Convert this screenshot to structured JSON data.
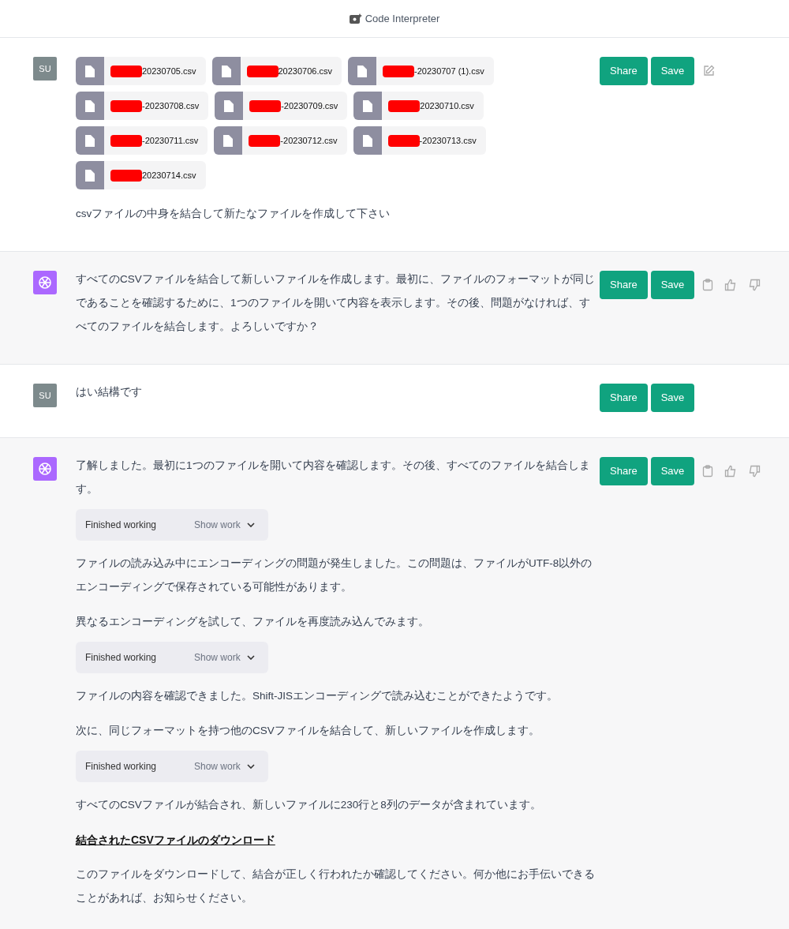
{
  "header": {
    "title": "Code Interpreter"
  },
  "messages": [
    {
      "kind": "user",
      "avatar": "SU",
      "files": [
        {
          "name": "20230705.csv",
          "redacted": true
        },
        {
          "name": "20230706.csv",
          "redacted": true
        },
        {
          "name": "-20230707 (1).csv",
          "redacted": true
        },
        {
          "name": "-20230708.csv",
          "redacted": true
        },
        {
          "name": "-20230709.csv",
          "redacted": true
        },
        {
          "name": "20230710.csv",
          "redacted": true
        },
        {
          "name": "-20230711.csv",
          "redacted": true
        },
        {
          "name": "-20230712.csv",
          "redacted": true
        },
        {
          "name": "-20230713.csv",
          "redacted": true
        },
        {
          "name": "20230714.csv",
          "redacted": true
        }
      ],
      "blocks": [
        {
          "kind": "paragraph",
          "text": "csvファイルの中身を結合して新たなファイルを作成して下さい"
        }
      ],
      "buttons": [
        "Share",
        "Save"
      ],
      "actions": [
        {
          "kind": "edit"
        }
      ]
    },
    {
      "kind": "assistant",
      "blocks": [
        {
          "kind": "paragraph",
          "text": "すべてのCSVファイルを結合して新しいファイルを作成します。最初に、ファイルのフォーマットが同じであることを確認するために、1つのファイルを開いて内容を表示します。その後、問題がなければ、すべてのファイルを結合します。よろしいですか？"
        }
      ],
      "buttons": [
        "Share",
        "Save"
      ],
      "actions": [
        {
          "kind": "copy"
        },
        {
          "kind": "thumbs-up"
        },
        {
          "kind": "thumbs-down"
        }
      ]
    },
    {
      "kind": "user",
      "avatar": "SU",
      "blocks": [
        {
          "kind": "paragraph",
          "text": "はい結構です"
        }
      ],
      "buttons": [
        "Share",
        "Save"
      ]
    },
    {
      "kind": "assistant",
      "blocks": [
        {
          "kind": "paragraph",
          "text": "了解しました。最初に1つのファイルを開いて内容を確認します。その後、すべてのファイルを結合します。"
        },
        {
          "kind": "tool",
          "status": "Finished working",
          "toggle": "Show work"
        },
        {
          "kind": "paragraph",
          "text": "ファイルの読み込み中にエンコーディングの問題が発生しました。この問題は、ファイルがUTF-8以外のエンコーディングで保存されている可能性があります。"
        },
        {
          "kind": "paragraph",
          "text": "異なるエンコーディングを試して、ファイルを再度読み込んでみます。"
        },
        {
          "kind": "tool",
          "status": "Finished working",
          "toggle": "Show work"
        },
        {
          "kind": "paragraph",
          "text": "ファイルの内容を確認できました。Shift-JISエンコーディングで読み込むことができたようです。"
        },
        {
          "kind": "paragraph",
          "text": "次に、同じフォーマットを持つ他のCSVファイルを結合して、新しいファイルを作成します。"
        },
        {
          "kind": "tool",
          "status": "Finished working",
          "toggle": "Show work"
        },
        {
          "kind": "paragraph",
          "text": "すべてのCSVファイルが結合され、新しいファイルに230行と8列のデータが含まれています。"
        },
        {
          "kind": "link",
          "text": "結合されたCSVファイルのダウンロード"
        },
        {
          "kind": "paragraph",
          "text": "このファイルをダウンロードして、結合が正しく行われたか確認してください。何か他にお手伝いできることがあれば、お知らせください。"
        }
      ],
      "buttons": [
        "Share",
        "Save"
      ],
      "actions": [
        {
          "kind": "copy"
        },
        {
          "kind": "thumbs-up"
        },
        {
          "kind": "thumbs-down"
        }
      ]
    }
  ]
}
